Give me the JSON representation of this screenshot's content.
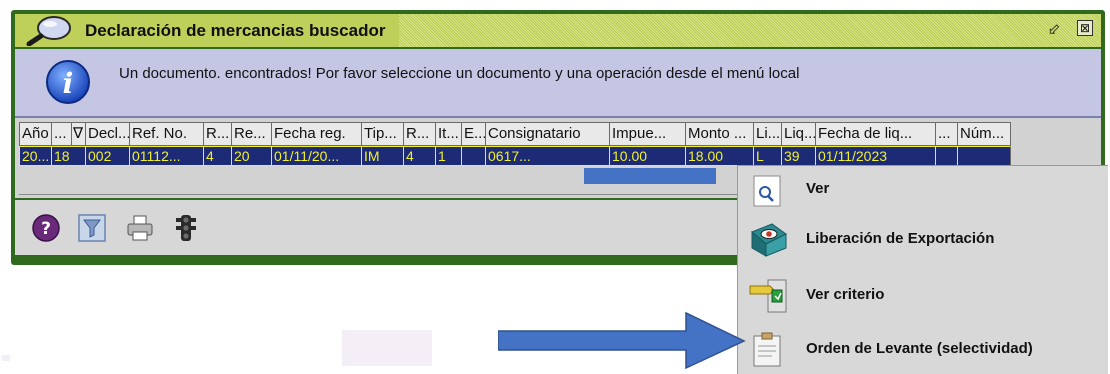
{
  "window": {
    "title": "Declaración de mercancias buscador",
    "restore_glyph": "⬃",
    "close_glyph": "⊠"
  },
  "info": {
    "message": "Un documento. encontrados! Por favor seleccione un documento y una operación desde el menú local"
  },
  "grid": {
    "columns": [
      "Año",
      "...",
      "∇",
      "Decl...",
      "Ref. No.",
      "R...",
      "Re...",
      "Fecha reg.",
      "Tip...",
      "R...",
      "It...",
      "E...",
      "Consignatario",
      "Impue...",
      "Monto ...",
      "Li...",
      "Liq...",
      "Fecha de liq...",
      "...",
      "Núm..."
    ],
    "row": [
      "20...",
      "18",
      "",
      "002",
      "01112...",
      "4",
      "20",
      "01/11/20...",
      "IM",
      "4",
      "1",
      "",
      "0617...",
      "10.00",
      "18.00",
      "L",
      "39",
      "01/11/2023",
      "",
      ""
    ]
  },
  "toolbar": {
    "icons": [
      "help-icon",
      "filter-icon",
      "print-icon",
      "traffic-light-icon"
    ]
  },
  "context_menu": {
    "items": [
      {
        "label": "Ver",
        "icon": "magnifier-icon"
      },
      {
        "label": "Liberación de Exportación",
        "icon": "eye-icon"
      },
      {
        "label": "Ver criterio",
        "icon": "criteria-icon"
      },
      {
        "label": "Orden de Levante (selectividad)",
        "icon": "document-icon"
      }
    ]
  },
  "colors": {
    "window_frame": "#2f6a1e",
    "title_bar": "#bfd05a",
    "info_bar": "#c4c6e4",
    "row_selected_bg": "#1d2a75",
    "row_selected_text": "#f0f030",
    "arrow": "#4472c4"
  }
}
